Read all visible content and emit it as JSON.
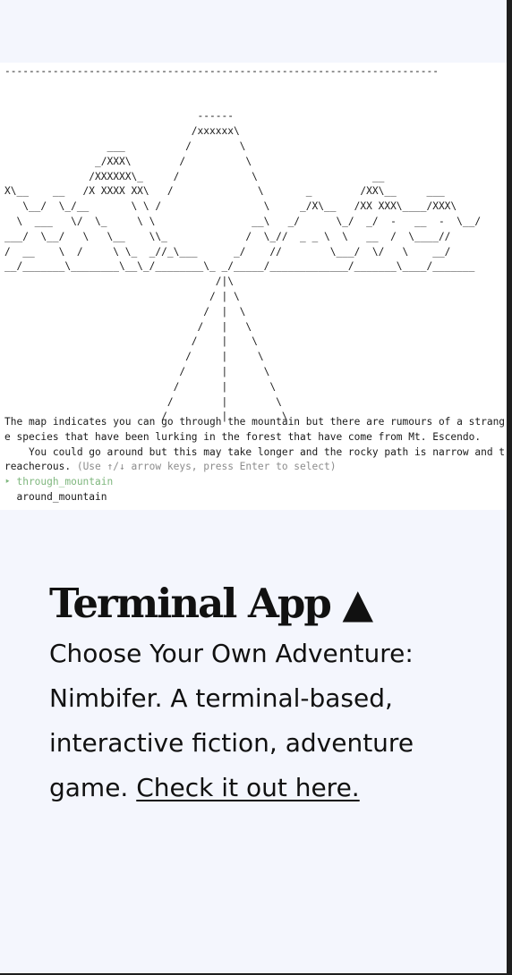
{
  "terminal": {
    "ascii_art": "------------------------------------------------------------------------\n\n\n                                ------\n                               /xxxxxx\\\n                 ___          /        \\\n               _/XXX\\        /          \\\n              /XXXXXX\\_     /            \\                   __\nX\\__    __   /X XXXX XX\\   /              \\       _        /XX\\__     ___\n   \\__/  \\_/__       \\ \\ /                 \\     _/X\\__   /XX XXX\\____/XXX\\\n  \\  ___   \\/  \\_     \\ \\                __\\   _/      \\_/  _/  -   __  -  \\__/\n___/  \\__/   \\   \\__    \\\\_             /  \\_//  _ _ \\  \\   __  /  \\____//\n/  __    \\  /     \\ \\_  _//_\\___      _/    //        \\___/  \\/   \\    __/\n__/_______\\________\\__\\_/________\\_ _/_____/_____________/_______\\____/_______\n                                   /|\\\n                                  / | \\\n                                 /  |  \\\n                                /   |   \\\n                               /    |    \\\n                              /     |     \\\n                             /      |      \\\n                            /       |       \\\n                           /        |        \\\n                          /         |         \\",
    "story_line_1": "The map indicates you can go through the mountain but there are rumours of a strang",
    "story_line_2": "e species that have been lurking in the forest that have come from Mt. Escendo.",
    "story_line_3": "    You could go around but this may take longer and the rocky path is narrow and t",
    "story_line_4": "reacherous.",
    "hint": " (Use ↑/↓ arrow keys, press Enter to select)",
    "options": [
      {
        "label": "‣ through_mountain",
        "selected": true
      },
      {
        "label": "  around_mountain",
        "selected": false
      }
    ]
  },
  "project": {
    "title": "Terminal App ▲",
    "description": "Choose Your Own Adventure: Nimbifer. A terminal-based, interactive fiction, adventure game.",
    "link_text": "Check it out here."
  },
  "colors": {
    "background": "#f4f6fd",
    "selected_option": "#7fb77e",
    "hint": "#8c8c8c"
  }
}
